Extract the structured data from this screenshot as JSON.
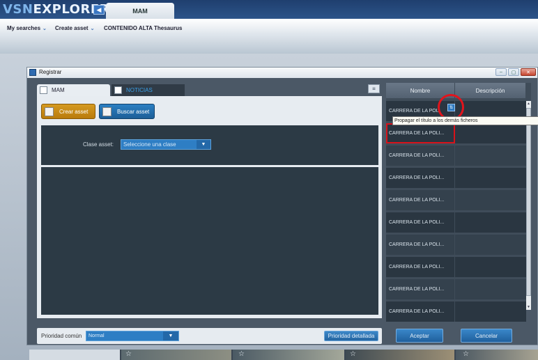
{
  "app": {
    "logo_vsn": "VSN",
    "logo_explorer": "EXPLORER",
    "tab": "MAM",
    "back_icon": "chevron-left-icon"
  },
  "menu": [
    {
      "label": "My searches",
      "has_dropdown": true
    },
    {
      "label": "Create asset",
      "has_dropdown": true
    },
    {
      "label": "CONTENIDO ALTA",
      "has_dropdown": false
    },
    {
      "label": "Thesaurus",
      "has_dropdown": false
    }
  ],
  "dialog": {
    "title": "Registrar",
    "tabs": [
      {
        "label": "MAM",
        "active": true
      },
      {
        "label": "NOTICIAS",
        "active": false
      }
    ],
    "crear_asset": "Crear asset",
    "buscar_asset": "Buscar asset",
    "clase_label": "Clase asset:",
    "clase_placeholder": "Seleccione una clase",
    "prioridad_label": "Prioridad común",
    "prioridad_value": "Normal",
    "prioridad_detallada": "Prioridad detallada",
    "aceptar": "Aceptar",
    "cancelar": "Cancelar"
  },
  "table": {
    "headers": [
      "Nombre",
      "Descripción"
    ],
    "rows": [
      {
        "nombre": "CARRERA DE LA POLI...",
        "descripcion": ""
      },
      {
        "nombre": "CARRERA DE LA POLI...",
        "descripcion": ""
      },
      {
        "nombre": "CARRERA DE LA POLI...",
        "descripcion": ""
      },
      {
        "nombre": "CARRERA DE LA POLI...",
        "descripcion": ""
      },
      {
        "nombre": "CARRERA DE LA POLI...",
        "descripcion": ""
      },
      {
        "nombre": "CARRERA DE LA POLI...",
        "descripcion": ""
      },
      {
        "nombre": "CARRERA DE LA POLI...",
        "descripcion": ""
      },
      {
        "nombre": "CARRERA DE LA POLI...",
        "descripcion": ""
      },
      {
        "nombre": "CARRERA DE LA POLI...",
        "descripcion": ""
      },
      {
        "nombre": "CARRERA DE LA POLI...",
        "descripcion": ""
      }
    ],
    "first_row_visible": "CARRERA DE LA POL",
    "selected_row": 1,
    "tooltip": "Propagar el título a los demás ficheros"
  },
  "colors": {
    "accent_blue": "#2e7ec4",
    "crear_orange": "#d59a21",
    "highlight_red": "#e2141c",
    "panel_dark": "#2c3a45"
  }
}
